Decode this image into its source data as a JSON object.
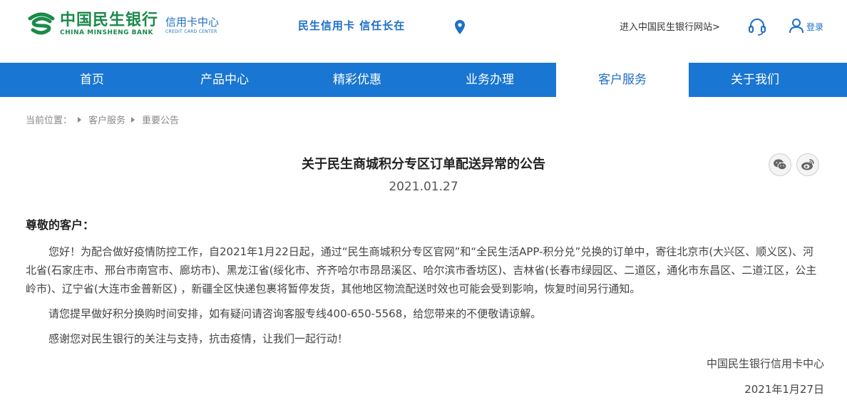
{
  "header": {
    "logo_cn": "中国民生银行",
    "logo_en": "CHINA MINSHENG BANK",
    "logo_sub_cn": "信用卡中心",
    "logo_sub_en": "CREDIT CARD CENTER",
    "slogan": "民生信用卡 信任长在",
    "visit_link": "进入中国民生银行网站>",
    "login": "登录",
    "brand_green": "#1a8a4a",
    "brand_blue": "#1f6fc5"
  },
  "nav": {
    "items": [
      {
        "label": "首页"
      },
      {
        "label": "产品中心"
      },
      {
        "label": "精彩优惠"
      },
      {
        "label": "业务办理"
      },
      {
        "label": "客户服务"
      },
      {
        "label": "关于我们"
      }
    ],
    "active_index": 4,
    "bar_color": "#1976d2"
  },
  "breadcrumb": {
    "items": [
      "当前位置：",
      "客户服务",
      "重要公告"
    ]
  },
  "article": {
    "title": "关于民生商城积分专区订单配送异常的公告",
    "date": "2021.01.27",
    "greeting": "尊敬的客户：",
    "paragraphs": [
      "您好！为配合做好疫情防控工作，自2021年1月22日起，通过“民生商城积分专区官网”和“全民生活APP-积分兑”兑换的订单中，寄往北京市(大兴区、顺义区)、河北省(石家庄市、邢台市南宫市、廊坊市)、黑龙江省(绥化市、齐齐哈尔市昂昂溪区、哈尔滨市香坊区)、吉林省(长春市绿园区、二道区，通化市东昌区、二道江区，公主岭市)、辽宁省(大连市金普新区) ，新疆全区快递包裹将暂停发货，其他地区物流配送时效也可能会受到影响，恢复时间另行通知。",
      "请您提早做好积分换购时间安排，如有疑问请咨询客服专线400-650-5568，给您带来的不便敬请谅解。",
      "感谢您对民生银行的关注与支持，抗击疫情，让我们一起行动！"
    ],
    "signature": "中国民生银行信用卡中心",
    "sign_date": "2021年1月27日"
  },
  "icons": {
    "logo": "minsheng-logo-icon",
    "location": "location-pin-icon",
    "service": "headset-icon",
    "user": "user-icon",
    "wechat": "wechat-icon",
    "weibo": "weibo-icon"
  }
}
